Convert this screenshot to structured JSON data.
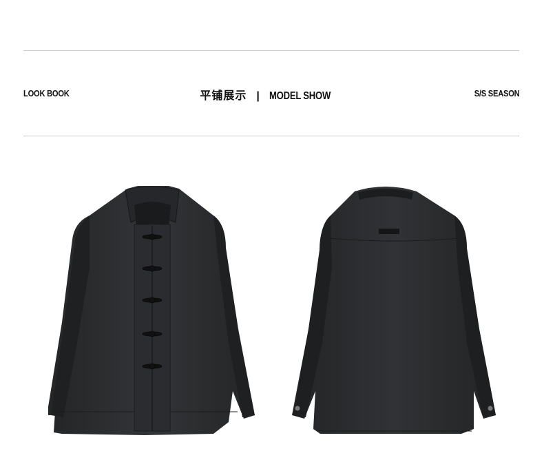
{
  "header": {
    "left_label": "LOOK BOOK",
    "center_cn": "平铺展示",
    "center_separator": "|",
    "center_en": "MODEL SHOW",
    "right_label": "S/S SEASON"
  },
  "images": {
    "front": "jacket-front-photo",
    "back": "jacket-back-photo"
  },
  "colors": {
    "background": "#ffffff",
    "rule": "#c9c9c9",
    "garment": "#2f3032"
  }
}
